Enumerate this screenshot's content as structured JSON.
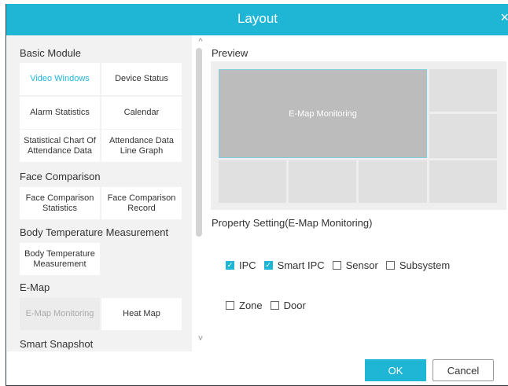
{
  "dialog": {
    "title": "Layout",
    "close_glyph": "×"
  },
  "left": {
    "basic_module": {
      "title": "Basic Module",
      "tiles": [
        "Video Windows",
        "Device Status",
        "Alarm Statistics",
        "Calendar",
        "Statistical Chart Of Attendance Data",
        "Attendance Data Line Graph"
      ]
    },
    "face_comparison": {
      "title": "Face Comparison",
      "tiles": [
        "Face Comparison Statistics",
        "Face Comparison Record"
      ]
    },
    "body_temp": {
      "title": "Body Temperature Measurement",
      "tiles": [
        "Body Temperature Measurement"
      ]
    },
    "emap": {
      "title": "E-Map",
      "tiles": [
        "E-Map Monitoring",
        "Heat Map"
      ]
    },
    "smart_snapshot": {
      "title": "Smart Snapshot"
    }
  },
  "scroll": {
    "up": "^",
    "down": "˅"
  },
  "preview": {
    "label": "Preview",
    "main_cell": "E-Map Monitoring"
  },
  "property": {
    "label": "Property Setting(E-Map Monitoring)",
    "row1": [
      {
        "label": "IPC",
        "checked": true
      },
      {
        "label": "Smart IPC",
        "checked": true
      },
      {
        "label": "Sensor",
        "checked": false
      },
      {
        "label": "Subsystem",
        "checked": false
      }
    ],
    "row2": [
      {
        "label": "Zone",
        "checked": false
      },
      {
        "label": "Door",
        "checked": false
      }
    ]
  },
  "buttons": {
    "ok": "OK",
    "cancel": "Cancel"
  },
  "colors": {
    "accent": "#1fb6d6",
    "panel": "#f2f2f2"
  }
}
